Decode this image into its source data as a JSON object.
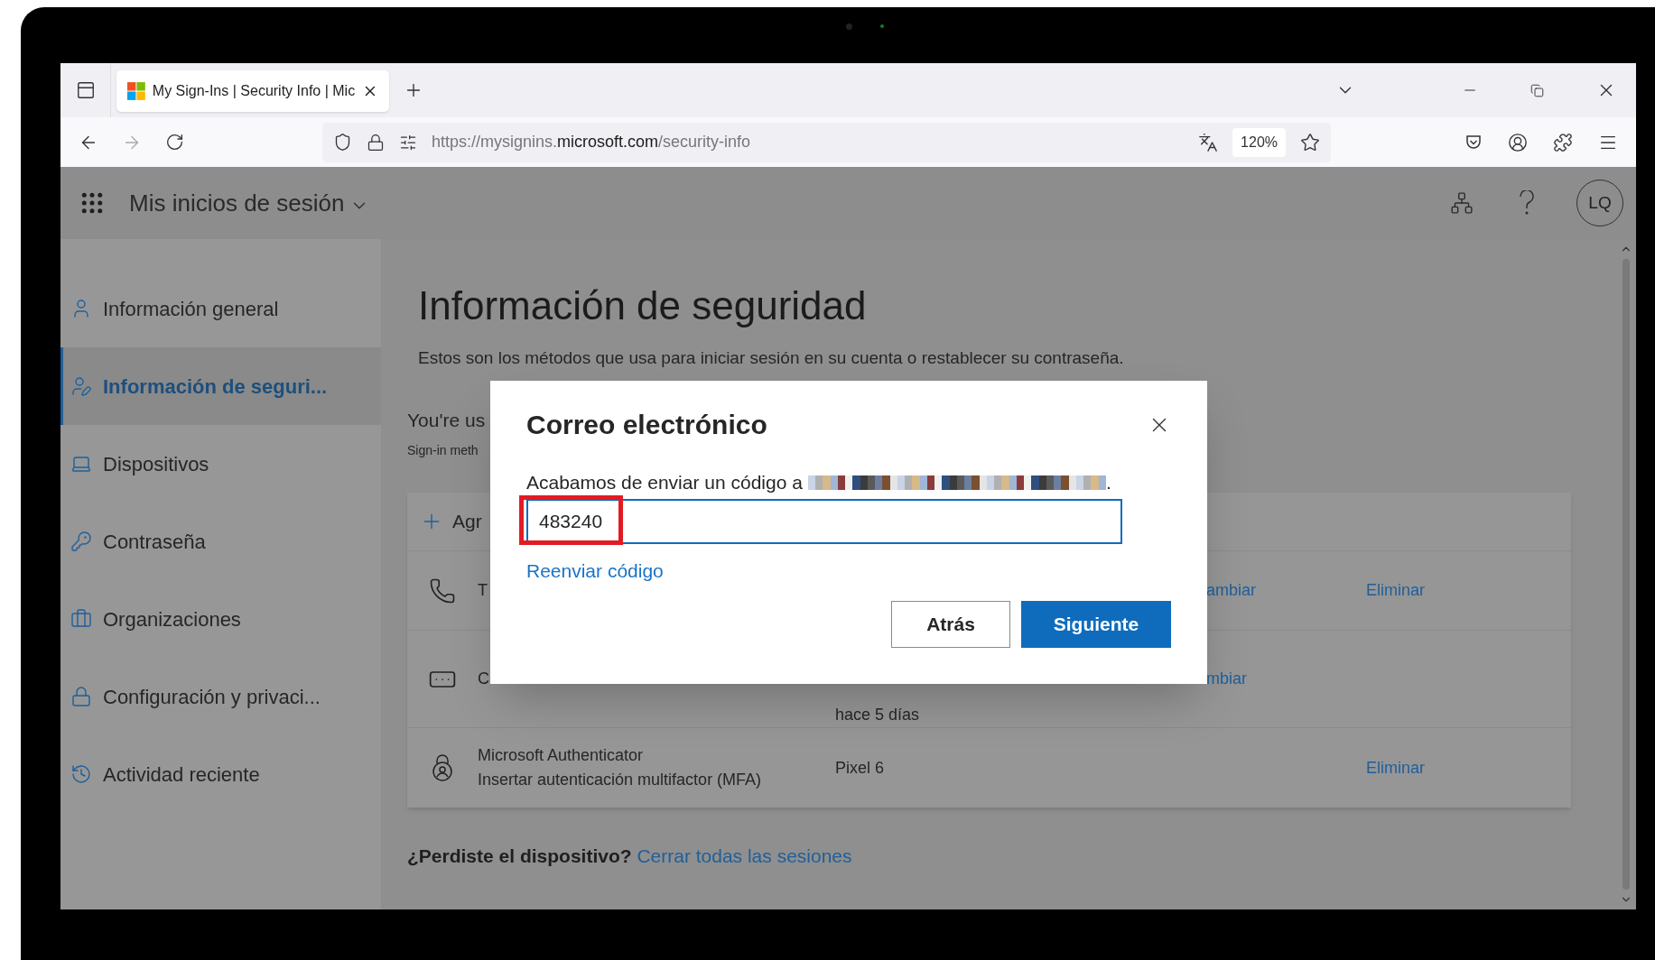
{
  "browser": {
    "tab_title": "My Sign-Ins | Security Info | Mic",
    "url_prefix": "https://mysignins.",
    "url_domain": "microsoft.com",
    "url_path": "/security-info",
    "zoom": "120%"
  },
  "header": {
    "app_title": "Mis inicios de sesión",
    "avatar": "LQ"
  },
  "sidebar": {
    "items": [
      {
        "label": "Información general",
        "selected": false
      },
      {
        "label": "Información de seguri...",
        "selected": true
      },
      {
        "label": "Dispositivos",
        "selected": false
      },
      {
        "label": "Contraseña",
        "selected": false
      },
      {
        "label": "Organizaciones",
        "selected": false
      },
      {
        "label": "Configuración y privaci...",
        "selected": false
      },
      {
        "label": "Actividad reciente",
        "selected": false
      }
    ]
  },
  "page": {
    "title": "Información de seguridad",
    "subtitle": "Estos son los métodos que usa para iniciar sesión en su cuenta o restablecer su contraseña.",
    "section_heading": "You're us",
    "section_sub": "Sign-in meth",
    "add_label": "Agr",
    "methods": [
      {
        "name": "T",
        "action": "ambiar",
        "remove": "Eliminar"
      },
      {
        "name": "C",
        "detail": "hace 5 días",
        "action": "mbiar"
      },
      {
        "name": "Microsoft Authenticator",
        "name_sub": "Insertar autenticación multifactor (MFA)",
        "detail": "Pixel 6",
        "remove": "Eliminar"
      }
    ],
    "footer_question": "¿Perdiste el dispositivo?",
    "footer_link": "Cerrar todas las sesiones"
  },
  "modal": {
    "title": "Correo electrónico",
    "message": "Acabamos de enviar un código a",
    "message_end": ".",
    "code_value": "483240",
    "highlighted": true,
    "link": "Reenviar código",
    "buttons": [
      {
        "label": "Atrás",
        "kind": "secondary"
      },
      {
        "label": "Siguiente",
        "kind": "primary"
      }
    ]
  }
}
